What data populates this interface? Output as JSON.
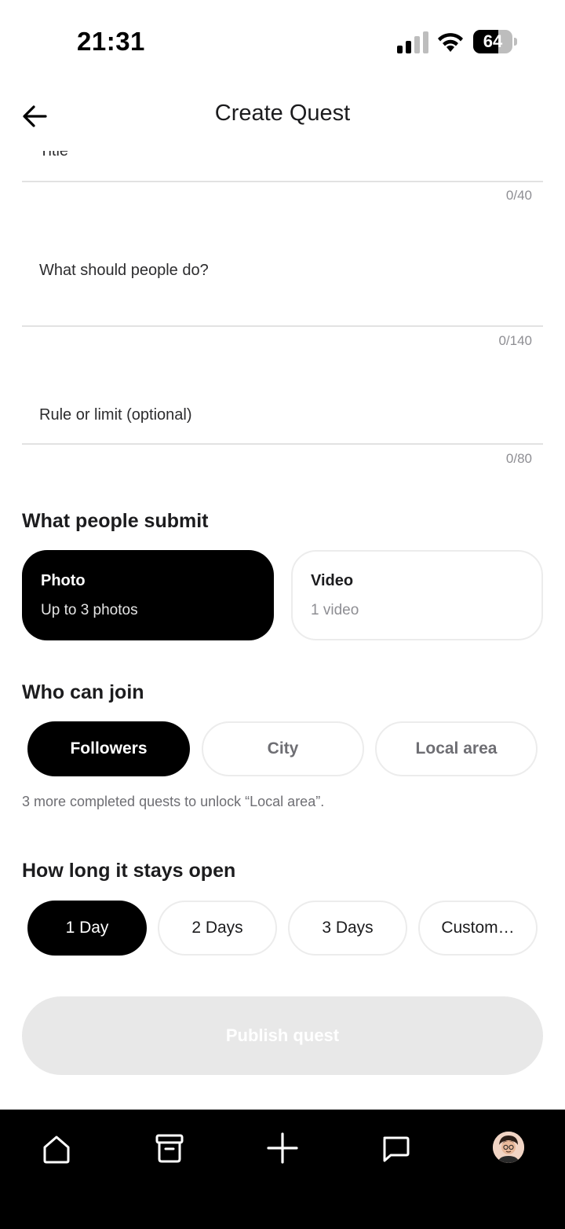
{
  "status_bar": {
    "time": "21:31",
    "battery_level": "64",
    "battery_fraction": 0.64
  },
  "header": {
    "title": "Create Quest",
    "back_icon": "arrow-left-icon"
  },
  "fields": [
    {
      "label": "Title",
      "counter": "0/40"
    },
    {
      "label": "What should people do?",
      "counter": "0/140"
    },
    {
      "label": "Rule or limit (optional)",
      "counter": "0/80"
    }
  ],
  "submit_section": {
    "title": "What people submit",
    "options": [
      {
        "title": "Photo",
        "subtitle": "Up to 3 photos",
        "selected": true
      },
      {
        "title": "Video",
        "subtitle": "1 video",
        "selected": false
      }
    ]
  },
  "join_section": {
    "title": "Who can join",
    "options": [
      {
        "label": "Followers",
        "selected": true
      },
      {
        "label": "City",
        "selected": false
      },
      {
        "label": "Local area",
        "selected": false
      }
    ],
    "hint": "3 more completed quests to unlock “Local area”."
  },
  "duration_section": {
    "title": "How long it stays open",
    "options": [
      {
        "label": "1 Day",
        "selected": true
      },
      {
        "label": "2 Days",
        "selected": false
      },
      {
        "label": "3 Days",
        "selected": false
      },
      {
        "label": "Custom…",
        "selected": false
      }
    ]
  },
  "publish_button": {
    "label": "Publish quest",
    "enabled": false
  },
  "tab_bar": {
    "tabs": [
      {
        "icon": "home-icon"
      },
      {
        "icon": "archive-icon"
      },
      {
        "icon": "plus-icon"
      },
      {
        "icon": "chat-icon"
      },
      {
        "icon": "profile-avatar"
      }
    ]
  },
  "colors": {
    "selected_bg": "#000000",
    "unselected_border": "#ececec",
    "disabled_button": "#e8e8e8",
    "tab_bar_bg": "#000000"
  }
}
